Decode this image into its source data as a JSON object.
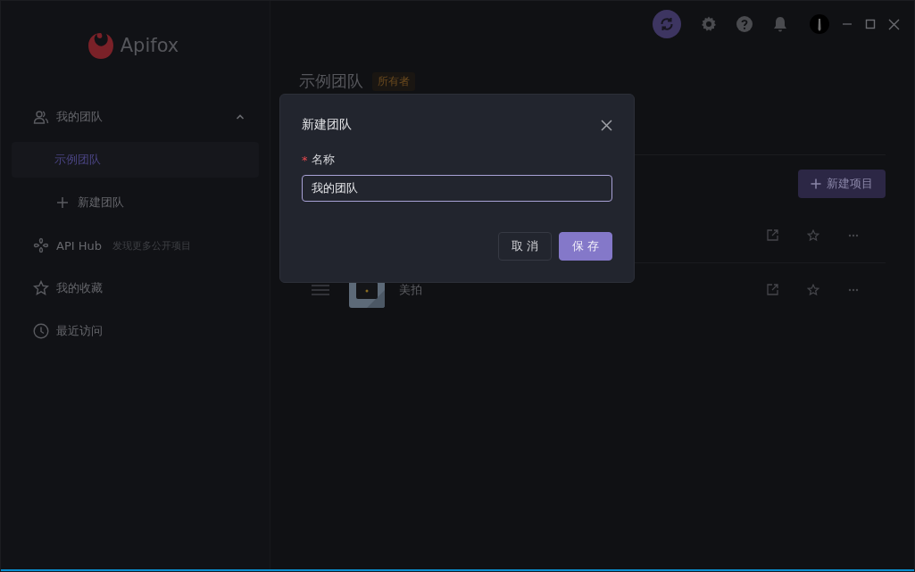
{
  "sidebar": {
    "logo": "Apifox",
    "team_group": {
      "label": "我的团队",
      "expanded": true,
      "teams": [
        {
          "label": "示例团队",
          "selected": true
        }
      ],
      "add_label": "新建团队"
    },
    "nav": [
      {
        "kind": "hub",
        "label": "API Hub",
        "hint": "发现更多公开项目"
      },
      {
        "kind": "star",
        "label": "我的收藏"
      },
      {
        "kind": "clock",
        "label": "最近访问"
      }
    ]
  },
  "main": {
    "team_title": "示例团队",
    "role_badge": "所有者",
    "new_project_button": "新建项目",
    "projects": [
      {
        "kind": "covered"
      },
      {
        "kind": "named",
        "name": "美拍"
      }
    ]
  },
  "dialog": {
    "title": "新建团队",
    "field": {
      "label": "名称",
      "required_mark": "*",
      "value": "我的团队"
    },
    "buttons": [
      {
        "label": "取 消",
        "kind": "secondary"
      },
      {
        "label": "保 存",
        "kind": "primary"
      }
    ]
  }
}
